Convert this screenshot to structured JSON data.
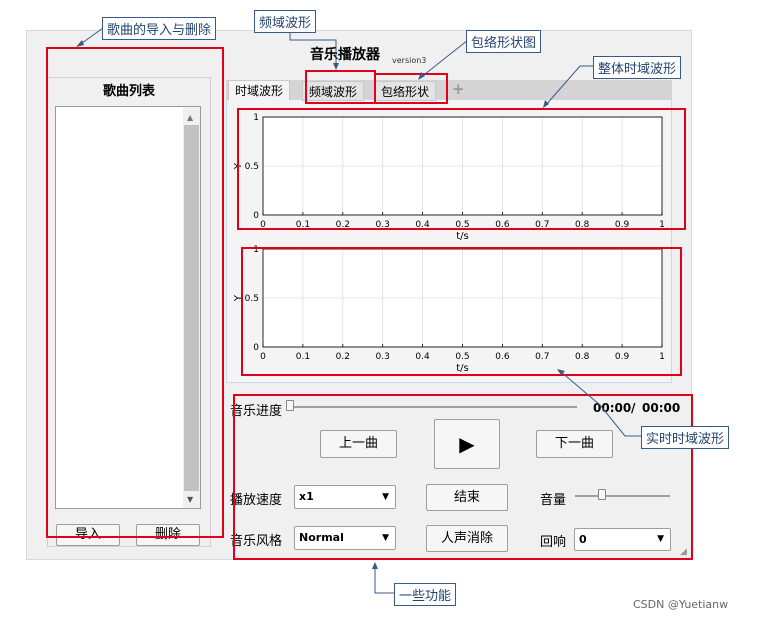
{
  "window": {
    "title": "音乐播放器",
    "version": "version3"
  },
  "song_list": {
    "title": "歌曲列表",
    "import_label": "导入",
    "delete_label": "删除"
  },
  "tabs": [
    {
      "label": "时域波形"
    },
    {
      "label": "频域波形"
    },
    {
      "label": "包络形状"
    }
  ],
  "add_tab": "+",
  "plot1": {
    "ylabel": "Y",
    "xlabel": "t/s",
    "x_ticks": [
      "0",
      "0.1",
      "0.2",
      "0.3",
      "0.4",
      "0.5",
      "0.6",
      "0.7",
      "0.8",
      "0.9",
      "1"
    ],
    "y_ticks": [
      "0",
      "0.5",
      "1"
    ]
  },
  "plot2": {
    "ylabel": "Y",
    "xlabel": "t/s",
    "x_ticks": [
      "0",
      "0.1",
      "0.2",
      "0.3",
      "0.4",
      "0.5",
      "0.6",
      "0.7",
      "0.8",
      "0.9",
      "1"
    ],
    "y_ticks": [
      "0",
      "0.5",
      "1"
    ]
  },
  "progress": {
    "label": "音乐进度",
    "current": "00:00",
    "separator": "/",
    "total": "00:00"
  },
  "controls": {
    "prev": "上一曲",
    "play": "▶",
    "next": "下一曲",
    "stop": "结束",
    "vocal_remove": "人声消除"
  },
  "speed": {
    "label": "播放速度",
    "value": "x1"
  },
  "style": {
    "label": "音乐风格",
    "value": "Normal"
  },
  "volume": {
    "label": "音量"
  },
  "echo": {
    "label": "回响",
    "value": "0"
  },
  "annotations": {
    "song_import_delete": "歌曲的导入与删除",
    "freq_wave": "频域波形",
    "envelope": "包络形状图",
    "overall_wave": "整体时域波形",
    "realtime_wave": "实时时域波形",
    "functions": "一些功能"
  },
  "watermark": "CSDN @Yuetianw"
}
